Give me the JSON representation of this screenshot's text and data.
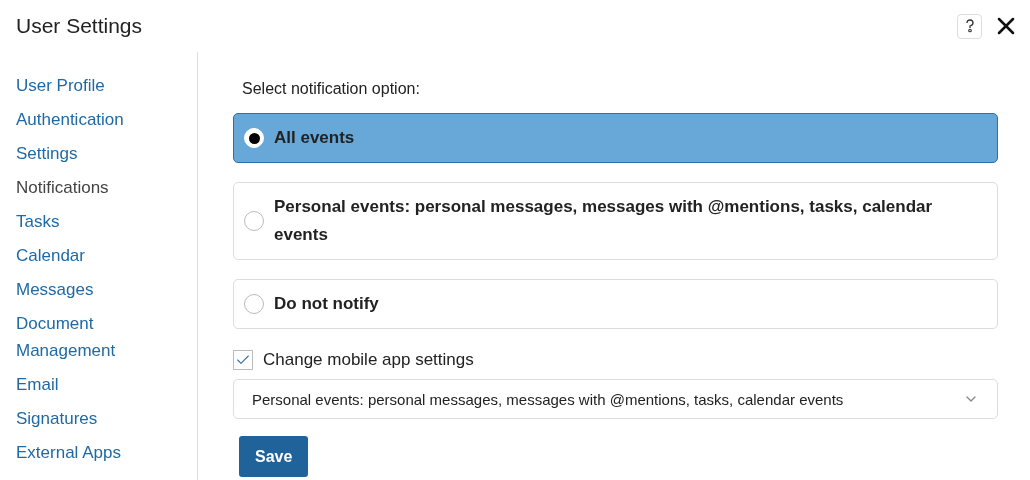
{
  "window": {
    "title": "User Settings"
  },
  "sidebar": {
    "items": [
      {
        "label": "User Profile",
        "selected": false
      },
      {
        "label": "Authentication",
        "selected": false
      },
      {
        "label": "Settings",
        "selected": false
      },
      {
        "label": "Notifications",
        "selected": true
      },
      {
        "label": "Tasks",
        "selected": false
      },
      {
        "label": "Calendar",
        "selected": false
      },
      {
        "label": "Messages",
        "selected": false
      },
      {
        "label": "Document Management",
        "selected": false
      },
      {
        "label": "Email",
        "selected": false
      },
      {
        "label": "Signatures",
        "selected": false
      },
      {
        "label": "External Apps",
        "selected": false
      }
    ]
  },
  "notification": {
    "label": "Select notification option:",
    "options": [
      {
        "label": "All events",
        "selected": true
      },
      {
        "label": "Personal events: personal messages, messages with @mentions, tasks, calendar events",
        "selected": false
      },
      {
        "label": "Do not notify",
        "selected": false
      }
    ]
  },
  "mobile": {
    "label": "Change mobile app settings",
    "checked": true,
    "select_value": "Personal events: personal messages, messages with @mentions, tasks, calendar events"
  },
  "buttons": {
    "save": "Save"
  }
}
